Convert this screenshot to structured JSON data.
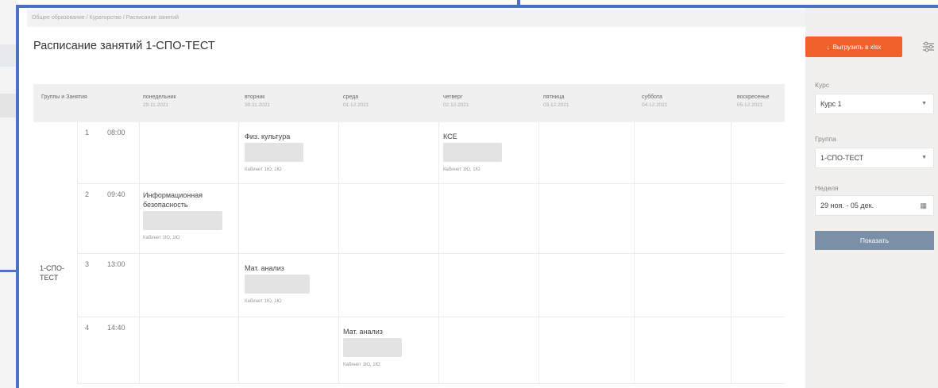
{
  "breadcrumb": "Общее образование / Кураторство / Расписание занятий",
  "title": "Расписание занятий 1-СПО-ТЕСТ",
  "header": {
    "group_col": "Группы и Занятия",
    "days": [
      {
        "name": "понедельник",
        "date": "29.11.2021"
      },
      {
        "name": "вторник",
        "date": "30.11.2021"
      },
      {
        "name": "среда",
        "date": "01.12.2021"
      },
      {
        "name": "четверг",
        "date": "02.12.2021"
      },
      {
        "name": "пятница",
        "date": "03.12.2021"
      },
      {
        "name": "суббота",
        "date": "04.12.2021"
      },
      {
        "name": "воскресенье",
        "date": "05.12.2021"
      }
    ]
  },
  "group": "1-СПО-ТЕСТ",
  "rows": [
    {
      "num": "1",
      "time": "08:00"
    },
    {
      "num": "2",
      "time": "09:40"
    },
    {
      "num": "3",
      "time": "13:00"
    },
    {
      "num": "4",
      "time": "14:40"
    }
  ],
  "lessons": [
    {
      "title": "Физ. культура",
      "room": "Кабинет 1Ю, 1Ю"
    },
    {
      "title": "КСЕ",
      "room": "Кабинет 1Ю, 1Ю"
    },
    {
      "title": "Информационная безопасность",
      "room": "Кабинет 1Ю, 1Ю"
    },
    {
      "title": "Мат. анализ",
      "room": "Кабинет 1Ю, 1Ю"
    },
    {
      "title": "Мат. анализ",
      "room": "Кабинет 1Ю, 1Ю"
    }
  ],
  "sidebar": {
    "export_label": "Выгрузить в xlsx",
    "course_label": "Курс",
    "course_value": "Курс 1",
    "group_label": "Группа",
    "group_value": "1-СПО-ТЕСТ",
    "week_label": "Неделя",
    "week_value": "29 ноя. - 05 дек.",
    "show_label": "Показать"
  },
  "colors": {
    "accent": "#f0602a",
    "show_button": "#7b8fa6",
    "frame": "#4a72c2"
  }
}
